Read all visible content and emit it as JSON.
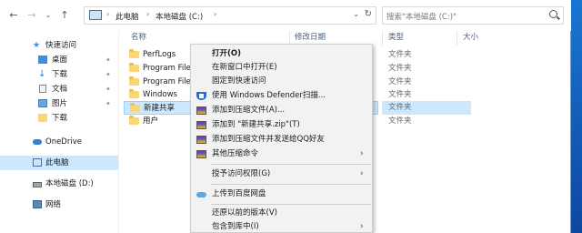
{
  "address": {
    "crumbs": [
      "此电脑",
      "本地磁盘 (C:)"
    ],
    "search_placeholder": "搜索\"本地磁盘 (C:)\""
  },
  "sidebar": {
    "items": [
      {
        "label": "快速访问",
        "pinned": false
      },
      {
        "label": "桌面",
        "pinned": true
      },
      {
        "label": "下载",
        "pinned": true
      },
      {
        "label": "文档",
        "pinned": true
      },
      {
        "label": "图片",
        "pinned": true
      },
      {
        "label": "下载",
        "pinned": false
      },
      {
        "label": "OneDrive",
        "pinned": false
      },
      {
        "label": "此电脑",
        "selected": true
      },
      {
        "label": "本地磁盘 (D:)",
        "pinned": false
      },
      {
        "label": "网络",
        "pinned": false
      }
    ]
  },
  "columns": {
    "name": "名称",
    "date": "修改日期",
    "type": "类型",
    "size": "大小"
  },
  "files": [
    {
      "name": "PerfLogs",
      "type": "文件夹"
    },
    {
      "name": "Program Files",
      "type": "文件夹"
    },
    {
      "name": "Program Files (x86)",
      "type": "文件夹"
    },
    {
      "name": "Windows",
      "type": "文件夹"
    },
    {
      "name": "新建共享",
      "type": "文件夹",
      "selected": true
    },
    {
      "name": "用户",
      "type": "文件夹"
    }
  ],
  "context_menu": {
    "items": [
      {
        "label": "打开(O)",
        "bold": true
      },
      {
        "label": "在新窗口中打开(E)"
      },
      {
        "label": "固定到快速访问"
      },
      {
        "label": "使用 Windows Defender扫描...",
        "icon": "shield-icon"
      },
      {
        "label": "添加到压缩文件(A)...",
        "icon": "archive-icon"
      },
      {
        "label": "添加到 \"新建共享.zip\"(T)",
        "icon": "archive-icon"
      },
      {
        "label": "添加到压缩文件并发送给QQ好友",
        "icon": "archive-icon"
      },
      {
        "label": "其他压缩命令",
        "icon": "archive-icon",
        "submenu": true
      },
      {
        "label": "授予访问权限(G)",
        "submenu": true
      },
      {
        "label": "上传到百度网盘",
        "icon": "cloud-icon"
      },
      {
        "label": "还原以前的版本(V)"
      },
      {
        "label": "包含到库中(I)",
        "submenu": true
      }
    ]
  }
}
